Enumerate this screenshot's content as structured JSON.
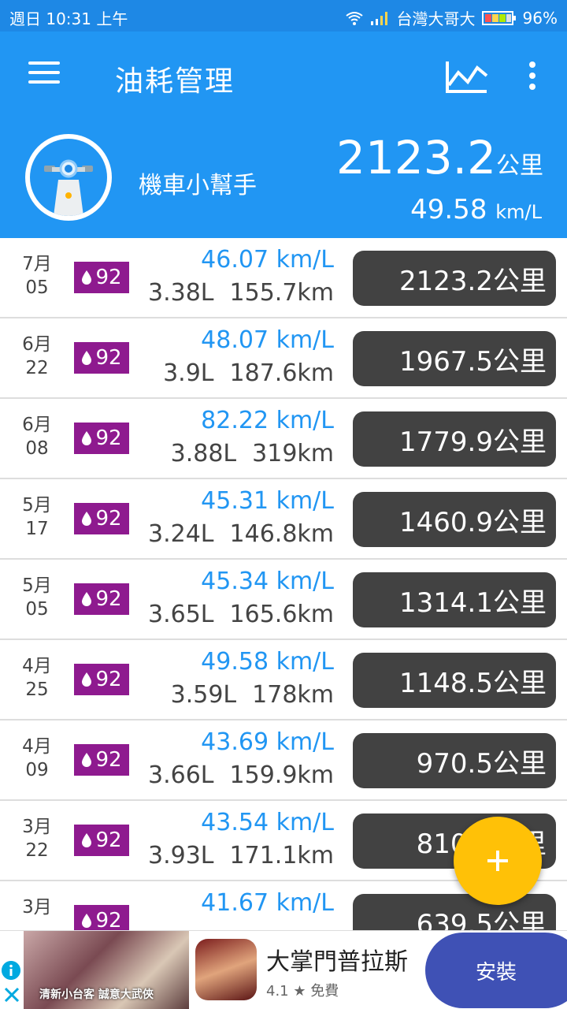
{
  "status_bar": {
    "datetime": "週日 10:31 上午",
    "carrier": "台灣大哥大",
    "battery": "96%"
  },
  "app_bar": {
    "title": "油耗管理",
    "icons": [
      "menu-icon",
      "chart-icon",
      "more-icon"
    ]
  },
  "summary": {
    "helper_label": "機車小幫手",
    "total_distance": "2123.2",
    "total_distance_unit": "公里",
    "avg_efficiency": "49.58",
    "avg_efficiency_unit": "km/L"
  },
  "records": [
    {
      "month": "7月",
      "day": "05",
      "fuel": "92",
      "efficiency": "46.07 km/L",
      "liters": "3.38L",
      "distance": "155.7km",
      "odometer": "2123.2公里"
    },
    {
      "month": "6月",
      "day": "22",
      "fuel": "92",
      "efficiency": "48.07 km/L",
      "liters": "3.9L",
      "distance": "187.6km",
      "odometer": "1967.5公里"
    },
    {
      "month": "6月",
      "day": "08",
      "fuel": "92",
      "efficiency": "82.22 km/L",
      "liters": "3.88L",
      "distance": "319km",
      "odometer": "1779.9公里"
    },
    {
      "month": "5月",
      "day": "17",
      "fuel": "92",
      "efficiency": "45.31 km/L",
      "liters": "3.24L",
      "distance": "146.8km",
      "odometer": "1460.9公里"
    },
    {
      "month": "5月",
      "day": "05",
      "fuel": "92",
      "efficiency": "45.34 km/L",
      "liters": "3.65L",
      "distance": "165.6km",
      "odometer": "1314.1公里"
    },
    {
      "month": "4月",
      "day": "25",
      "fuel": "92",
      "efficiency": "49.58 km/L",
      "liters": "3.59L",
      "distance": "178km",
      "odometer": "1148.5公里"
    },
    {
      "month": "4月",
      "day": "09",
      "fuel": "92",
      "efficiency": "43.69 km/L",
      "liters": "3.66L",
      "distance": "159.9km",
      "odometer": "970.5公里"
    },
    {
      "month": "3月",
      "day": "22",
      "fuel": "92",
      "efficiency": "43.54 km/L",
      "liters": "3.93L",
      "distance": "171.1km",
      "odometer": "810.6公里"
    },
    {
      "month": "3月",
      "day": "",
      "fuel": "92",
      "efficiency": "41.67 km/L",
      "liters": "",
      "distance": "",
      "odometer": "639.5公里"
    }
  ],
  "fab": {
    "icon": "plus-icon"
  },
  "ad": {
    "banner_text": "清新小台客 誠意大武俠",
    "app_title": "大掌門普拉斯",
    "rating": "4.1 ★ 免費",
    "install_label": "安裝"
  },
  "colors": {
    "primary": "#2196f3",
    "badge": "#8e1a8f",
    "odometer_bg": "#424242",
    "fab": "#ffc107",
    "install": "#3f51b5"
  }
}
